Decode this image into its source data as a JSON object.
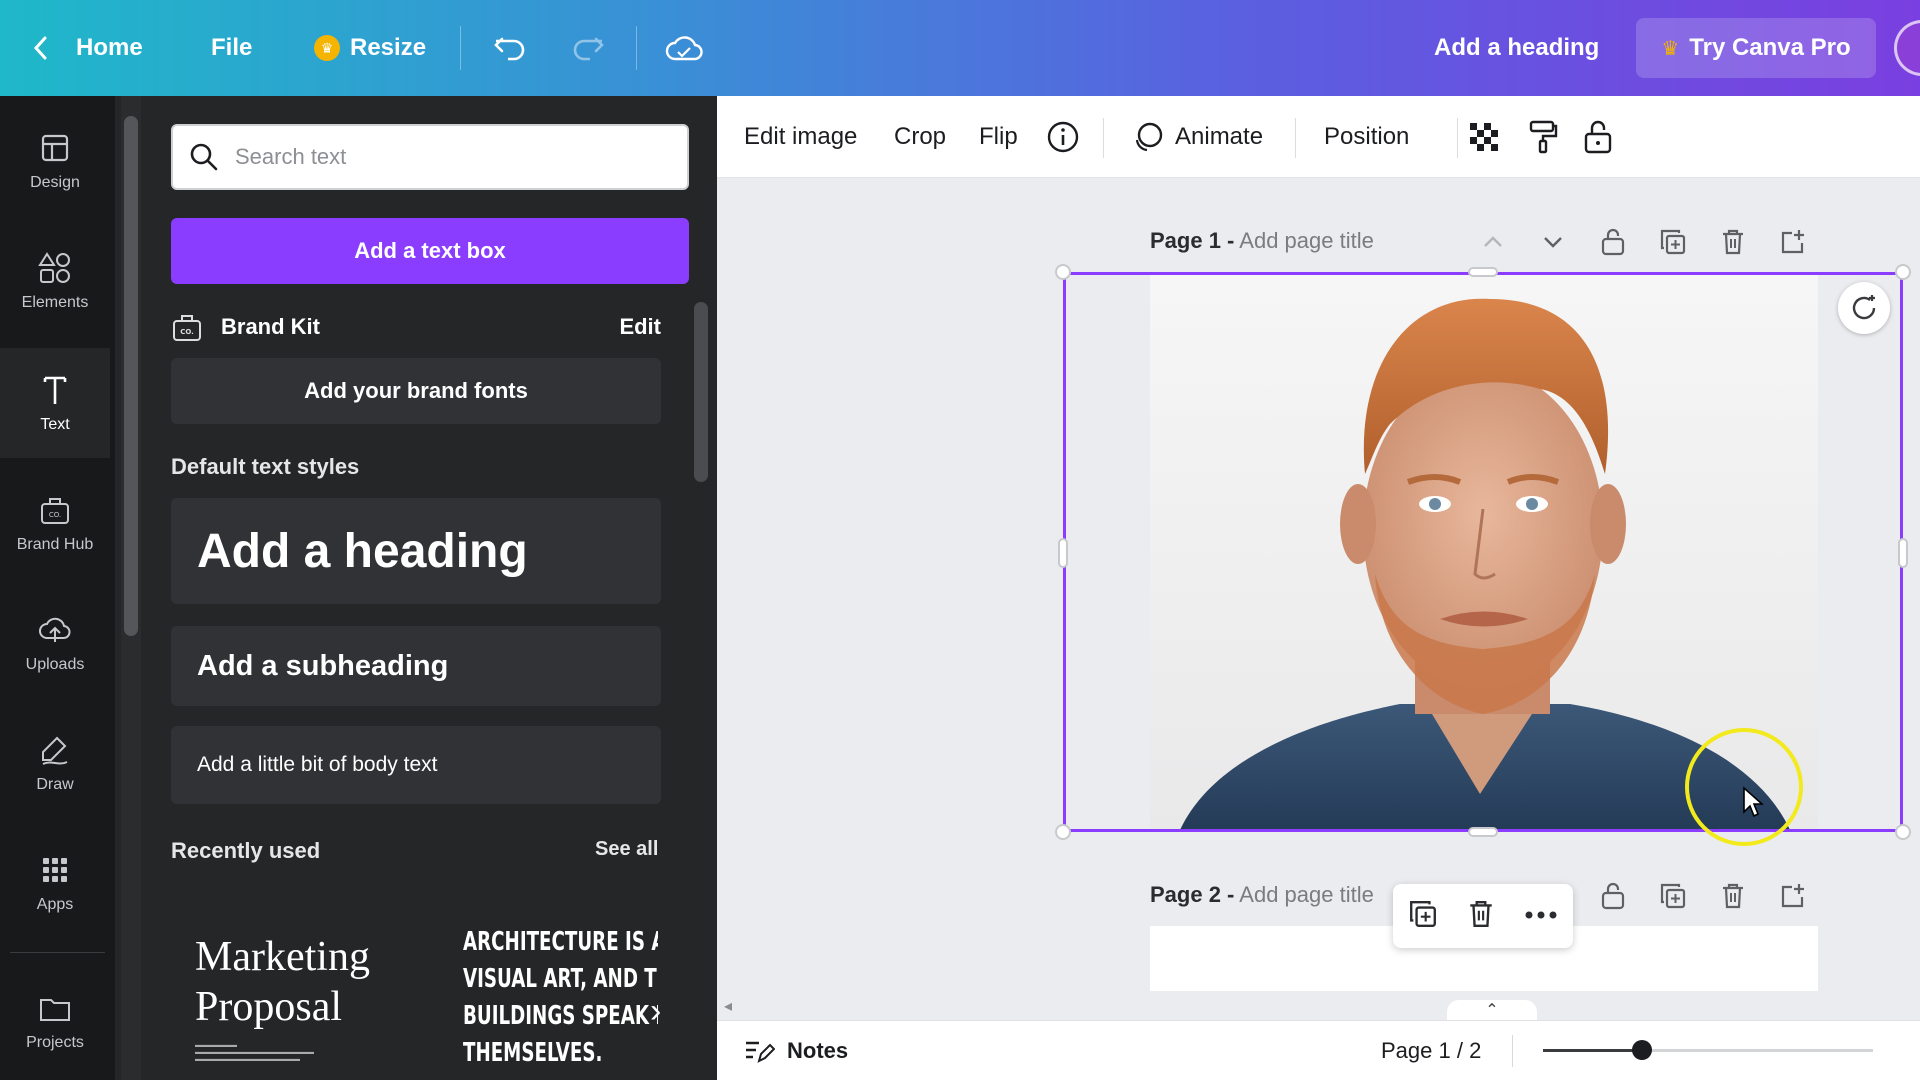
{
  "topbar": {
    "home_label": "Home",
    "file_label": "File",
    "resize_label": "Resize",
    "heading_label": "Add a heading",
    "pro_label": "Try Canva Pro"
  },
  "rail": {
    "items": [
      {
        "label": "Design",
        "icon": "layout-icon"
      },
      {
        "label": "Elements",
        "icon": "shapes-icon"
      },
      {
        "label": "Text",
        "icon": "text-icon",
        "active": true
      },
      {
        "label": "Brand Hub",
        "icon": "briefcase-icon"
      },
      {
        "label": "Uploads",
        "icon": "cloud-upload-icon"
      },
      {
        "label": "Draw",
        "icon": "pen-icon"
      },
      {
        "label": "Apps",
        "icon": "grid-icon"
      },
      {
        "label": "Projects",
        "icon": "folder-icon"
      }
    ]
  },
  "panel": {
    "search_placeholder": "Search text",
    "add_textbox_label": "Add a text box",
    "brandkit_label": "Brand Kit",
    "brandkit_edit": "Edit",
    "brand_fonts_label": "Add your brand fonts",
    "default_styles_title": "Default text styles",
    "heading_label": "Add a heading",
    "subheading_label": "Add a subheading",
    "body_label": "Add a little bit of body text",
    "recent_title": "Recently used",
    "see_all": "See all",
    "recent_thumb_1": {
      "title": "Marketing Proposal",
      "line1": "Marketing",
      "line2": "Proposal"
    },
    "recent_thumb_2": {
      "lines": [
        "ARCHITECTURE IS A",
        "VISUAL ART, AND THE",
        "BUILDINGS SPEAK FO",
        "THEMSELVES."
      ]
    }
  },
  "toolbar": {
    "edit_image": "Edit image",
    "crop": "Crop",
    "flip": "Flip",
    "animate": "Animate",
    "position": "Position"
  },
  "canvas": {
    "page1": {
      "prefix": "Page 1 -",
      "title_placeholder": "Add page title"
    },
    "page2": {
      "prefix": "Page 2 -",
      "title_placeholder": "Add page title"
    }
  },
  "bottombar": {
    "notes_label": "Notes",
    "page_indicator": "Page 1 / 2",
    "zoom_fraction": 0.3
  },
  "colors": {
    "accent": "#8b3dff",
    "cursor_highlight": "#f2ea1c",
    "crown": "#f4b400"
  }
}
